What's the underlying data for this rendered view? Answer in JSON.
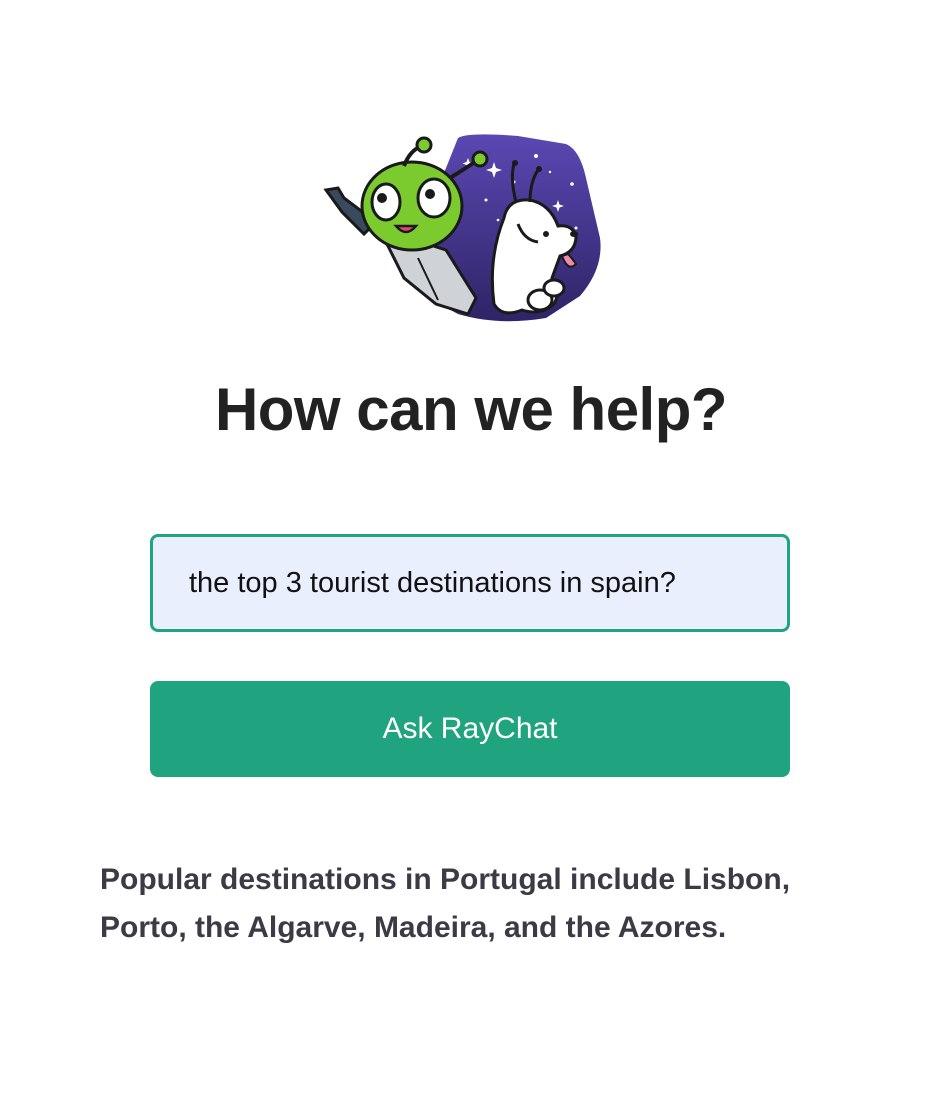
{
  "heading": "How can we help?",
  "question_input": {
    "value": "the top 3 tourist destinations in spain?"
  },
  "ask_button": {
    "label": "Ask RayChat"
  },
  "answer": {
    "text": "Popular destinations in Portugal include Lisbon, Porto, the Algarve, Madeira, and the Azores."
  },
  "mascot": {
    "icon": "alien-and-dog-mascot-icon"
  },
  "colors": {
    "accent": "#20a480",
    "input_background": "#e9effd",
    "heading": "#222222",
    "answer_text": "#3a3b45",
    "mascot_sky": "#4a3a99",
    "alien_green": "#7ccb2e"
  }
}
